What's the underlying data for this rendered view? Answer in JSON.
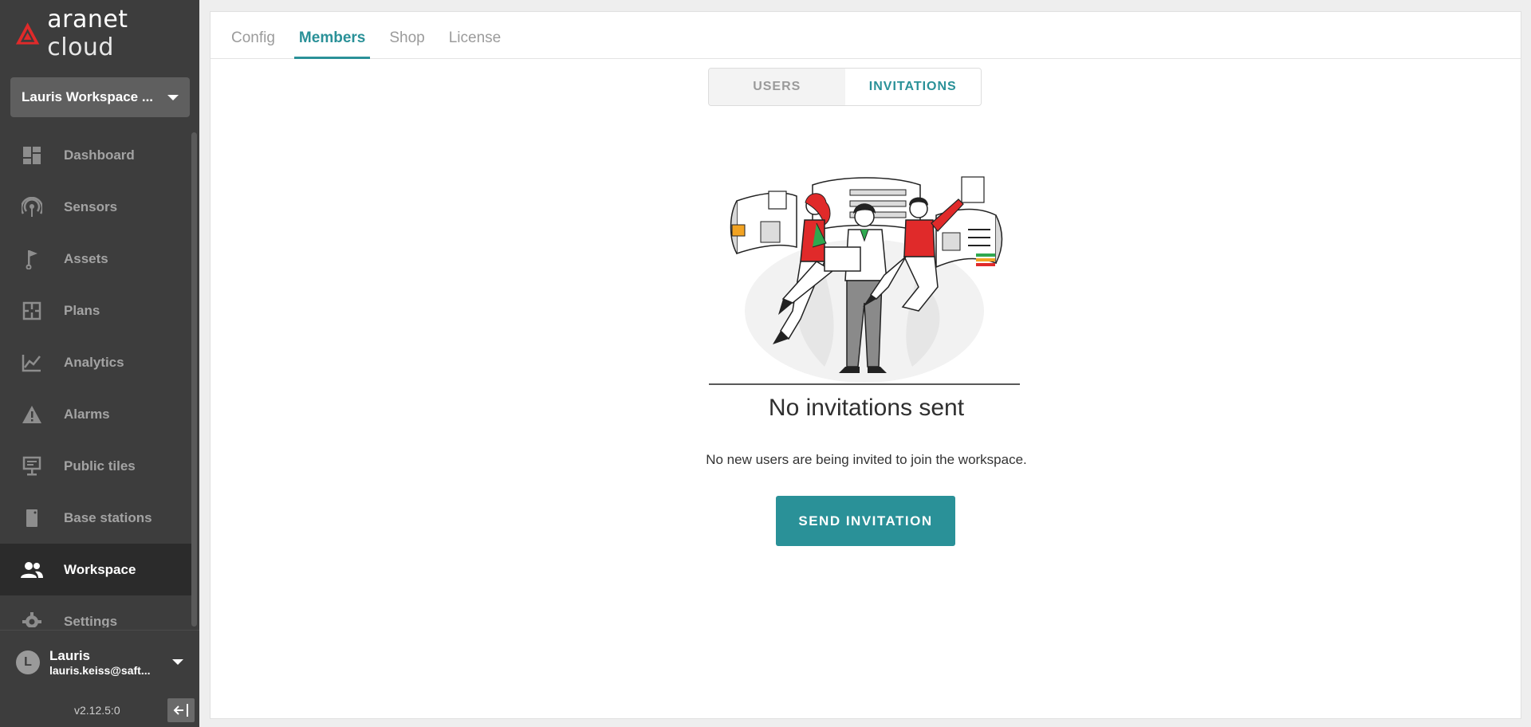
{
  "app": {
    "logo_name": "aranet",
    "logo_suffix": "cloud",
    "accent": "#2a9198"
  },
  "workspace_select": {
    "label": "Lauris Workspace ..."
  },
  "sidebar": {
    "items": [
      {
        "label": "Dashboard",
        "icon": "dashboard-icon"
      },
      {
        "label": "Sensors",
        "icon": "sensors-icon"
      },
      {
        "label": "Assets",
        "icon": "flag-icon"
      },
      {
        "label": "Plans",
        "icon": "floorplan-icon"
      },
      {
        "label": "Analytics",
        "icon": "chart-line-icon"
      },
      {
        "label": "Alarms",
        "icon": "warning-icon"
      },
      {
        "label": "Public tiles",
        "icon": "monitor-icon"
      },
      {
        "label": "Base stations",
        "icon": "router-icon"
      },
      {
        "label": "Workspace",
        "icon": "people-icon",
        "active": true
      },
      {
        "label": "Settings",
        "icon": "gear-icon"
      }
    ]
  },
  "user": {
    "initial": "L",
    "name": "Lauris",
    "email": "lauris.keiss@saft..."
  },
  "version": "v2.12.5:0",
  "tabs": [
    {
      "label": "Config",
      "active": false
    },
    {
      "label": "Members",
      "active": true
    },
    {
      "label": "Shop",
      "active": false
    },
    {
      "label": "License",
      "active": false
    }
  ],
  "segmented": {
    "users": "USERS",
    "invitations": "INVITATIONS",
    "selected": "INVITATIONS"
  },
  "empty_state": {
    "title": "No invitations sent",
    "description": "No new users are being invited to join the workspace.",
    "button": "SEND INVITATION"
  }
}
